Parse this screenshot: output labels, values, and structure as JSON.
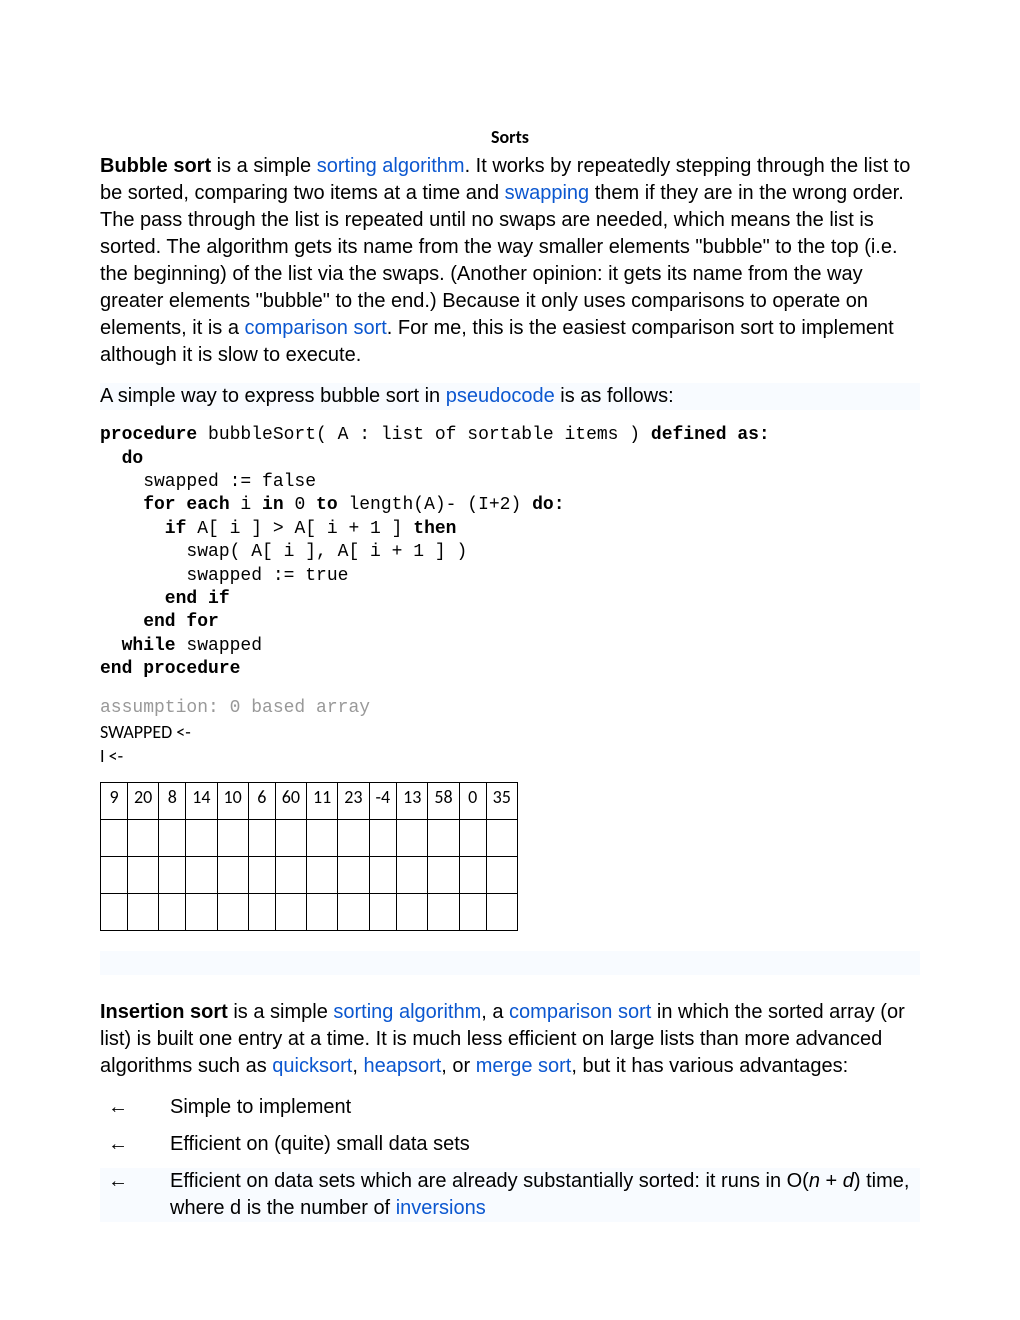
{
  "title": "Sorts",
  "bubble": {
    "strong": "Bubble sort",
    "t1": " is a simple ",
    "link_sort_algo": "sorting algorithm",
    "t2": ". It works by repeatedly stepping through the list to be sorted, comparing two items at a time and ",
    "link_swap": "swapping",
    "t3": " them if they are in the wrong order. The pass through the list is repeated until no swaps are needed, which means the list is sorted. The algorithm gets its name from the way smaller elements \"bubble\" to the top (i.e. the beginning) of the list via the swaps. (Another opinion: it gets its name from the way greater elements \"bubble\" to the end.) Because it only uses comparisons to operate on elements, it is a ",
    "link_comp_sort": "comparison sort",
    "t4": ". For me, this is the easiest comparison sort to implement although it is slow to execute."
  },
  "pseudo_intro": {
    "t1": "A simple way to express bubble sort in ",
    "link_pseudo": "pseudocode",
    "t2": " is as follows:"
  },
  "pseudo": {
    "l1a": "procedure",
    "l1b": " bubbleSort( A : list of sortable items ) ",
    "l1c": "defined as:",
    "l2": "  do",
    "l3": "    swapped := false",
    "l4a": "    for each",
    "l4b": " i ",
    "l4c": "in",
    "l4d": " 0 ",
    "l4e": "to",
    "l4f": " length(A)- (I+2) ",
    "l4g": "do:",
    "l5a": "      if",
    "l5b": " A[ i ] > A[ i + 1 ] ",
    "l5c": "then",
    "l6": "        swap( A[ i ], A[ i + 1 ] )",
    "l7": "        swapped := true",
    "l8": "      end if",
    "l9": "    end for",
    "l10a": "  while",
    "l10b": " swapped",
    "l11": "end procedure"
  },
  "assumption": "assumption:  0 based array",
  "swapped_line": "SWAPPED <-",
  "i_line": "I <-",
  "array": [
    "9",
    "20",
    "8",
    "14",
    "10",
    "6",
    "60",
    "11",
    "23",
    "-4",
    "13",
    "58",
    "0",
    "35"
  ],
  "insertion": {
    "strong": "Insertion sort",
    "t1": " is a simple ",
    "link_sort_algo": "sorting algorithm",
    "t2": ", a ",
    "link_comp_sort": "comparison sort",
    "t3": " in which the sorted array (or list) is built one entry at a time. It is much less efficient on large lists than more advanced algorithms such as ",
    "link_quick": "quicksort",
    "t4": ", ",
    "link_heap": "heapsort",
    "t5": ", or ",
    "link_merge": "merge sort",
    "t6": ", but it has various advantages:"
  },
  "advantages": {
    "a1": "Simple to implement",
    "a2": "Efficient on (quite) small data sets",
    "a3_pre": "Efficient on data sets which are already substantially sorted: it runs in O(",
    "a3_n": "n",
    "a3_mid": " + ",
    "a3_d": "d",
    "a3_post1": ") time, where d is the number of ",
    "a3_link": "inversions"
  },
  "arrow": "←"
}
